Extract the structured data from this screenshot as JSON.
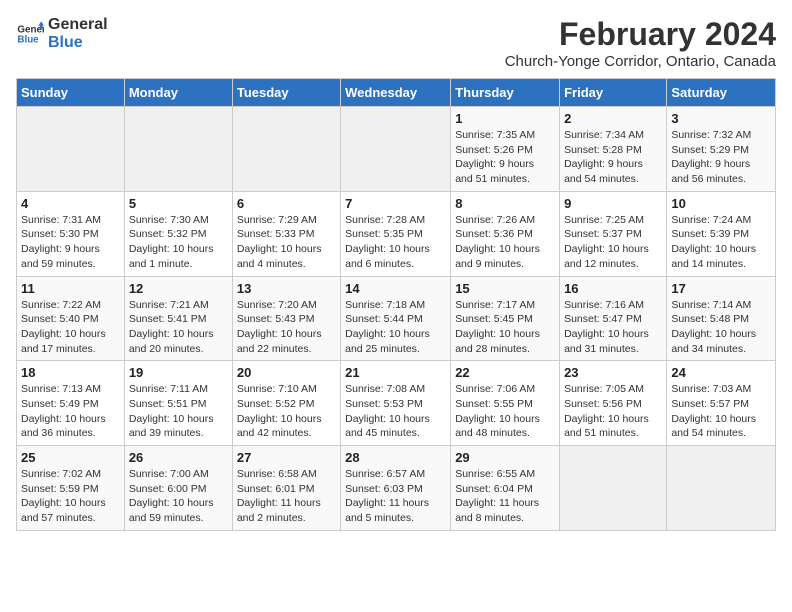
{
  "header": {
    "logo_line1": "General",
    "logo_line2": "Blue",
    "main_title": "February 2024",
    "sub_title": "Church-Yonge Corridor, Ontario, Canada"
  },
  "days_of_week": [
    "Sunday",
    "Monday",
    "Tuesday",
    "Wednesday",
    "Thursday",
    "Friday",
    "Saturday"
  ],
  "weeks": [
    [
      {
        "day": "",
        "info": ""
      },
      {
        "day": "",
        "info": ""
      },
      {
        "day": "",
        "info": ""
      },
      {
        "day": "",
        "info": ""
      },
      {
        "day": "1",
        "info": "Sunrise: 7:35 AM\nSunset: 5:26 PM\nDaylight: 9 hours\nand 51 minutes."
      },
      {
        "day": "2",
        "info": "Sunrise: 7:34 AM\nSunset: 5:28 PM\nDaylight: 9 hours\nand 54 minutes."
      },
      {
        "day": "3",
        "info": "Sunrise: 7:32 AM\nSunset: 5:29 PM\nDaylight: 9 hours\nand 56 minutes."
      }
    ],
    [
      {
        "day": "4",
        "info": "Sunrise: 7:31 AM\nSunset: 5:30 PM\nDaylight: 9 hours\nand 59 minutes."
      },
      {
        "day": "5",
        "info": "Sunrise: 7:30 AM\nSunset: 5:32 PM\nDaylight: 10 hours\nand 1 minute."
      },
      {
        "day": "6",
        "info": "Sunrise: 7:29 AM\nSunset: 5:33 PM\nDaylight: 10 hours\nand 4 minutes."
      },
      {
        "day": "7",
        "info": "Sunrise: 7:28 AM\nSunset: 5:35 PM\nDaylight: 10 hours\nand 6 minutes."
      },
      {
        "day": "8",
        "info": "Sunrise: 7:26 AM\nSunset: 5:36 PM\nDaylight: 10 hours\nand 9 minutes."
      },
      {
        "day": "9",
        "info": "Sunrise: 7:25 AM\nSunset: 5:37 PM\nDaylight: 10 hours\nand 12 minutes."
      },
      {
        "day": "10",
        "info": "Sunrise: 7:24 AM\nSunset: 5:39 PM\nDaylight: 10 hours\nand 14 minutes."
      }
    ],
    [
      {
        "day": "11",
        "info": "Sunrise: 7:22 AM\nSunset: 5:40 PM\nDaylight: 10 hours\nand 17 minutes."
      },
      {
        "day": "12",
        "info": "Sunrise: 7:21 AM\nSunset: 5:41 PM\nDaylight: 10 hours\nand 20 minutes."
      },
      {
        "day": "13",
        "info": "Sunrise: 7:20 AM\nSunset: 5:43 PM\nDaylight: 10 hours\nand 22 minutes."
      },
      {
        "day": "14",
        "info": "Sunrise: 7:18 AM\nSunset: 5:44 PM\nDaylight: 10 hours\nand 25 minutes."
      },
      {
        "day": "15",
        "info": "Sunrise: 7:17 AM\nSunset: 5:45 PM\nDaylight: 10 hours\nand 28 minutes."
      },
      {
        "day": "16",
        "info": "Sunrise: 7:16 AM\nSunset: 5:47 PM\nDaylight: 10 hours\nand 31 minutes."
      },
      {
        "day": "17",
        "info": "Sunrise: 7:14 AM\nSunset: 5:48 PM\nDaylight: 10 hours\nand 34 minutes."
      }
    ],
    [
      {
        "day": "18",
        "info": "Sunrise: 7:13 AM\nSunset: 5:49 PM\nDaylight: 10 hours\nand 36 minutes."
      },
      {
        "day": "19",
        "info": "Sunrise: 7:11 AM\nSunset: 5:51 PM\nDaylight: 10 hours\nand 39 minutes."
      },
      {
        "day": "20",
        "info": "Sunrise: 7:10 AM\nSunset: 5:52 PM\nDaylight: 10 hours\nand 42 minutes."
      },
      {
        "day": "21",
        "info": "Sunrise: 7:08 AM\nSunset: 5:53 PM\nDaylight: 10 hours\nand 45 minutes."
      },
      {
        "day": "22",
        "info": "Sunrise: 7:06 AM\nSunset: 5:55 PM\nDaylight: 10 hours\nand 48 minutes."
      },
      {
        "day": "23",
        "info": "Sunrise: 7:05 AM\nSunset: 5:56 PM\nDaylight: 10 hours\nand 51 minutes."
      },
      {
        "day": "24",
        "info": "Sunrise: 7:03 AM\nSunset: 5:57 PM\nDaylight: 10 hours\nand 54 minutes."
      }
    ],
    [
      {
        "day": "25",
        "info": "Sunrise: 7:02 AM\nSunset: 5:59 PM\nDaylight: 10 hours\nand 57 minutes."
      },
      {
        "day": "26",
        "info": "Sunrise: 7:00 AM\nSunset: 6:00 PM\nDaylight: 10 hours\nand 59 minutes."
      },
      {
        "day": "27",
        "info": "Sunrise: 6:58 AM\nSunset: 6:01 PM\nDaylight: 11 hours\nand 2 minutes."
      },
      {
        "day": "28",
        "info": "Sunrise: 6:57 AM\nSunset: 6:03 PM\nDaylight: 11 hours\nand 5 minutes."
      },
      {
        "day": "29",
        "info": "Sunrise: 6:55 AM\nSunset: 6:04 PM\nDaylight: 11 hours\nand 8 minutes."
      },
      {
        "day": "",
        "info": ""
      },
      {
        "day": "",
        "info": ""
      }
    ]
  ]
}
